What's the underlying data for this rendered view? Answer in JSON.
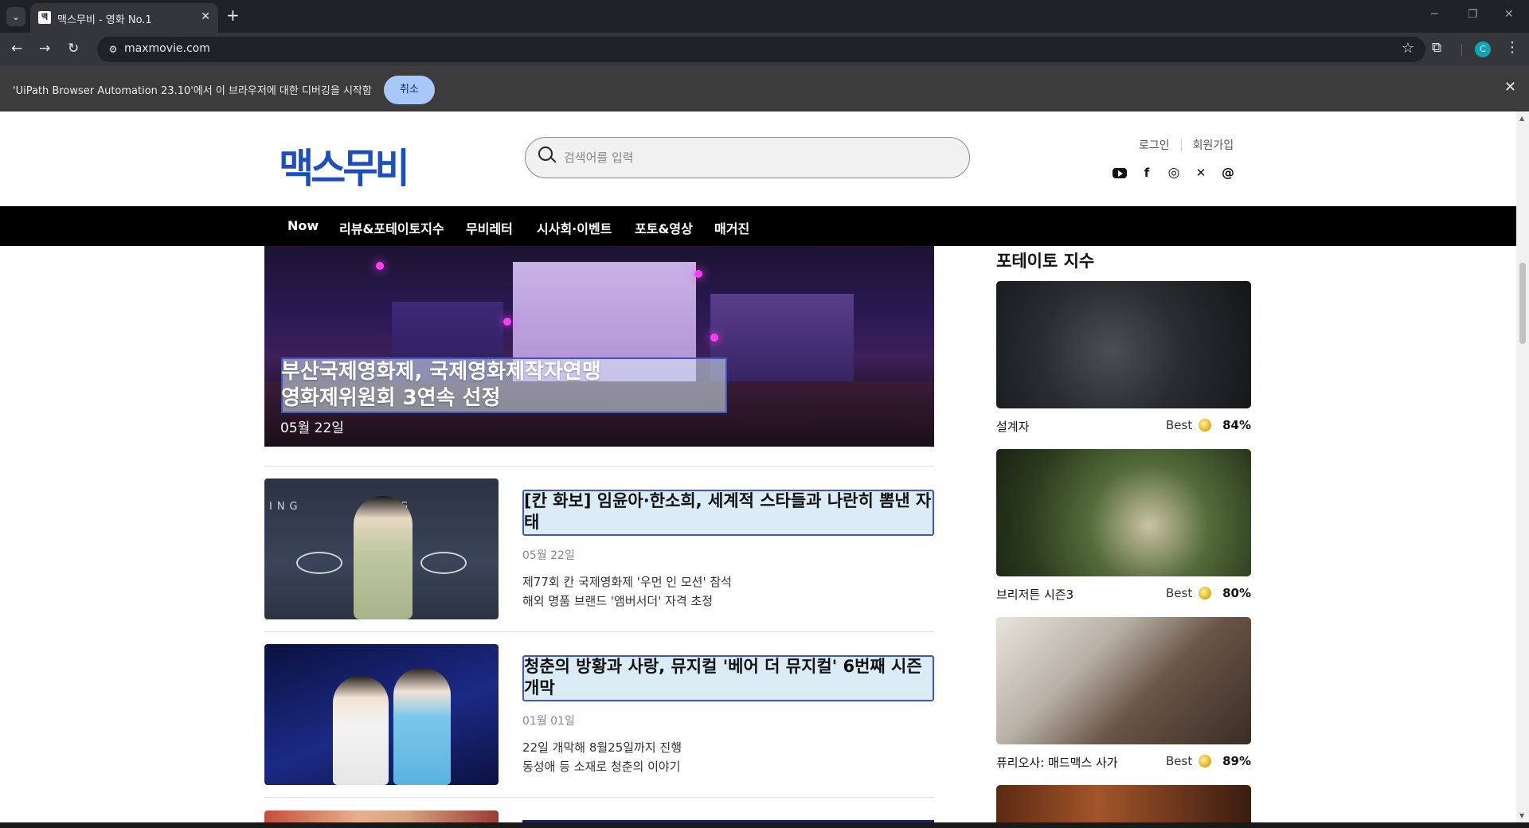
{
  "browser": {
    "tab_title": "맥스무비 - 영화 No.1",
    "favicon_text": "맥",
    "url": "maxmovie.com",
    "profile_initial": "C",
    "infobar_text": "'UiPath Browser Automation 23.10'에서 이 브라우저에 대한 디버깅을 시작함",
    "infobar_cancel": "취소"
  },
  "header": {
    "logo": "맥스무비",
    "search_placeholder": "검색어를 입력",
    "login": "로그인",
    "signup": "회원가입",
    "social_icons": [
      "youtube-icon",
      "facebook-icon",
      "instagram-icon",
      "x-icon",
      "threads-icon"
    ]
  },
  "nav": {
    "items": [
      "Now",
      "리뷰&포테이토지수",
      "무비레터",
      "시사회·이벤트",
      "포토&영상",
      "매거진"
    ]
  },
  "hero": {
    "title_line1": "부산국제영화제, 국제영화제작자연맹",
    "title_line2": "영화제위원회 3연속 선정",
    "date": "05월 22일"
  },
  "articles": [
    {
      "title": "[칸 화보] 임윤아·한소희, 세계적 스타들과 나란히 뽐낸 자태",
      "date": "05월 22일",
      "desc1": "제77회 칸 국제영화제 '우먼 인 모션' 참석",
      "desc2": "해외 명품 브랜드 '앰버서더' 자격 초정"
    },
    {
      "title": "청춘의 방황과 사랑, 뮤지컬 '베어 더 뮤지컬' 6번째 시즌 개막",
      "date": "01월 01일",
      "desc1": "22일 개막해 8월25일까지 진행",
      "desc2": "동성애 등 소재로 청춘의 이야기"
    }
  ],
  "sidebar": {
    "title": "포테이토 지수",
    "movies": [
      {
        "name": "설계자",
        "label": "Best",
        "score": "84%"
      },
      {
        "name": "브리저튼 시즌3",
        "label": "Best",
        "score": "80%"
      },
      {
        "name": "퓨리오사: 매드맥스 사가",
        "label": "Best",
        "score": "89%"
      }
    ]
  },
  "colors": {
    "logo": "#1a4fbd",
    "nav_bg": "#000000",
    "highlight_border": "#3f56c4",
    "highlight_fill": "#dbecf7"
  }
}
